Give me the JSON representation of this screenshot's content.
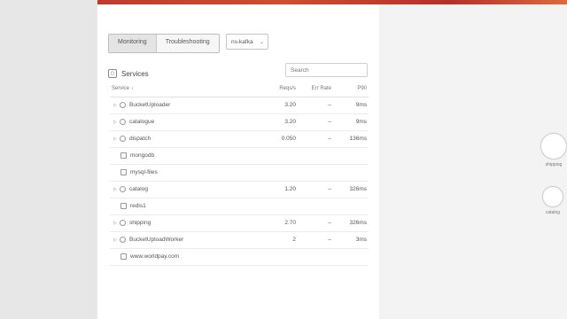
{
  "toolbar": {
    "tabs": [
      {
        "label": "Monitoring",
        "active": true
      },
      {
        "label": "Troubleshooting",
        "active": false
      }
    ],
    "namespace_select": "ns-kafka"
  },
  "services_panel": {
    "title": "Services",
    "search_placeholder": "Search",
    "columns": [
      "Service ↓",
      "Reqs/s",
      "Err Rate",
      "P90"
    ],
    "rows": [
      {
        "name": "BucketUploader",
        "kind": "parent",
        "reqs": "3.20",
        "err": "–",
        "p90": "9ms"
      },
      {
        "name": "catalogue",
        "kind": "parent",
        "reqs": "3.20",
        "err": "–",
        "p90": "9ms"
      },
      {
        "name": "dispatch",
        "kind": "parent",
        "reqs": "0.050",
        "err": "–",
        "p90": "136ms"
      },
      {
        "name": "mongodb",
        "kind": "child",
        "reqs": "",
        "err": "",
        "p90": ""
      },
      {
        "name": "mysql-files",
        "kind": "child",
        "reqs": "",
        "err": "",
        "p90": ""
      },
      {
        "name": "catalog",
        "kind": "parent",
        "reqs": "1.20",
        "err": "–",
        "p90": "326ms"
      },
      {
        "name": "redis1",
        "kind": "child",
        "reqs": "",
        "err": "",
        "p90": ""
      },
      {
        "name": "shipping",
        "kind": "parent",
        "reqs": "2.70",
        "err": "–",
        "p90": "326ms"
      },
      {
        "name": "BucketUploadWorker",
        "kind": "parent",
        "reqs": "2",
        "err": "–",
        "p90": "3ms"
      },
      {
        "name": "www.worldpay.com",
        "kind": "child",
        "reqs": "",
        "err": "",
        "p90": ""
      }
    ]
  },
  "graph": {
    "nodes": [
      {
        "label": "shipping"
      },
      {
        "label": "catalog"
      }
    ]
  }
}
